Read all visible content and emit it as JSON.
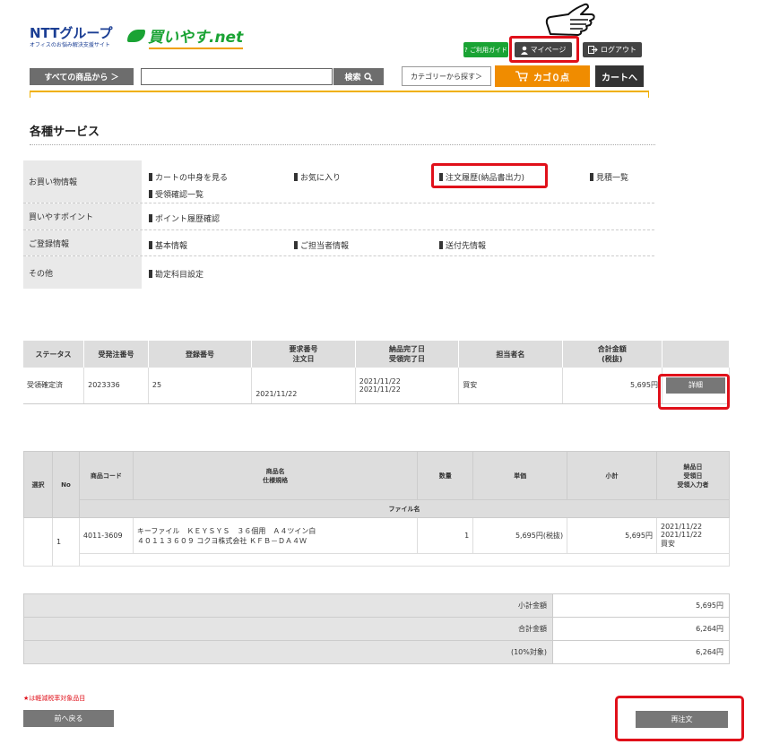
{
  "header": {
    "ntt_logo": "NTTグループ",
    "ntt_sub": "オフィスのお悩み解決支援サイト",
    "brand": "買いやす.net",
    "guide_label": "? ご利用ガイド",
    "mypage_label": "マイページ",
    "logout_label": "ログアウト",
    "all_products_label": "すべての商品から ＞",
    "search_value": "",
    "search_label": "検索",
    "category_label": "カテゴリーから探す＞",
    "cart_label": "カゴ０点",
    "to_cart_label": "カートへ"
  },
  "page": {
    "title": "各種サービス"
  },
  "services": {
    "rows": [
      {
        "label": "お買い物情報",
        "links": [
          "カートの中身を見る",
          "お気に入り",
          "注文履歴(納品書出力)",
          "見積一覧",
          "受領確認一覧"
        ]
      },
      {
        "label": "買いやすポイント",
        "links": [
          "ポイント履歴確認"
        ]
      },
      {
        "label": "ご登録情報",
        "links": [
          "基本情報",
          "ご担当者情報",
          "送付先情報"
        ]
      },
      {
        "label": "その他",
        "links": [
          "勘定科目設定"
        ]
      }
    ]
  },
  "order": {
    "headers": [
      "ステータス",
      "受発注番号",
      "登録番号",
      "要求番号",
      "注文日",
      "納品完了日",
      "受領完了日",
      "担当者名",
      "合計金額",
      "(税抜)"
    ],
    "row": {
      "status": "受領確定済",
      "order_no": "2023336",
      "reg_no": "25",
      "order_date": "2021/11/22",
      "delivered": "2021/11/22",
      "received": "2021/11/22",
      "person": "買安",
      "total": "5,695円",
      "detail_label": "詳細"
    }
  },
  "items": {
    "headers": {
      "select": "選択",
      "no": "No",
      "code": "商品コード",
      "name1": "商品名",
      "name2": "仕様規格",
      "qty": "数量",
      "unit": "単価",
      "sub": "小計",
      "d1": "納品日",
      "d2": "受領日",
      "d3": "受領入力者",
      "file": "ファイル名"
    },
    "row": {
      "no": "1",
      "code": "4011-3609",
      "name1": "キーファイル　ＫＥＹＳＹＳ　３６個用　Ａ４ツイン白",
      "name2": "４０１１３６０９ コクヨ株式会社 ＫＦＢ－ＤＡ４Ｗ",
      "qty": "1",
      "unit": "5,695円(税抜)",
      "sub": "5,695円",
      "d1": "2021/11/22",
      "d2": "2021/11/22",
      "d3": "買安"
    }
  },
  "totals": [
    {
      "label": "小計金額",
      "value": "5,695円"
    },
    {
      "label": "合計金額",
      "value": "6,264円"
    },
    {
      "label": "(10%対象)",
      "value": "6,264円"
    }
  ],
  "footer": {
    "reduced_note": "★は軽減税率対象品目",
    "back_label": "前へ戻る",
    "reorder_label": "再注文"
  },
  "colors": {
    "highlight": "#e0101a",
    "cart": "#f08c00",
    "green": "#1aa334",
    "ntt_blue": "#1c3f94"
  }
}
